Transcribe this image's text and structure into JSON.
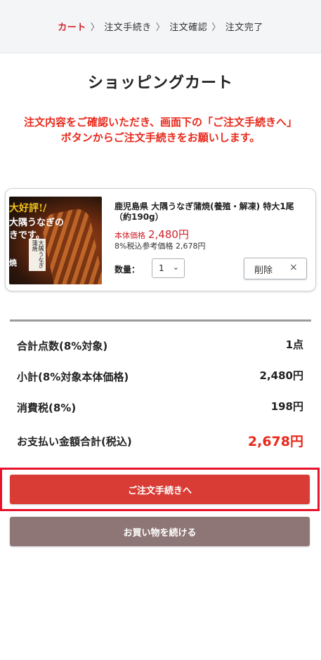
{
  "steps": {
    "items": [
      "カート",
      "注文手続き",
      "注文確認",
      "注文完了"
    ],
    "separator": "〉",
    "active_index": 0
  },
  "page_title": "ショッピングカート",
  "notice": "注文内容をご確認いただき、画面下の「ご注文手続きへ」ボタンからご注文手続きをお願いします。",
  "cart_item": {
    "image": {
      "line1": "大好評!/",
      "line2": "大隅うなぎの",
      "line3": "きです。",
      "line4": "焼",
      "label": "大隅うなぎ蒲焼"
    },
    "name": "鹿児島県 大隅うなぎ蒲焼(養殖・解凍) 特大1尾（約190g）",
    "price_label": "本体価格",
    "price": "2,480円",
    "tax_ref": "8%税込参考価格 2,678円",
    "qty_label": "数量：",
    "qty_value": "1",
    "delete_label": "削除",
    "delete_icon": "close-icon"
  },
  "summary": {
    "count_label": "合計点数(8%対象)",
    "count_value": "1点",
    "subtotal_label": "小計(8%対象本体価格)",
    "subtotal_value": "2,480円",
    "tax_label": "消費税(8%)",
    "tax_value": "198円",
    "total_label": "お支払い金額合計(税込)",
    "total_value": "2,678円"
  },
  "buttons": {
    "checkout": "ご注文手続きへ",
    "continue": "お買い物を続ける"
  },
  "colors": {
    "accent_red": "#d0222b",
    "checkout_button": "#d83c34",
    "continue_button": "#8f7676",
    "highlight_border": "#e8122a"
  }
}
